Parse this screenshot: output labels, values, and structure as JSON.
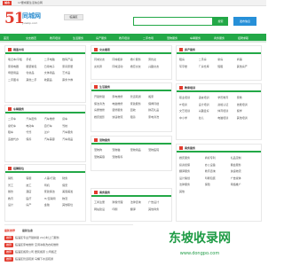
{
  "topbar": {
    "tag": "城市",
    "notice": "17要成都生活信息网"
  },
  "header": {
    "logo_num": "51",
    "brand": "同城网",
    "domain": "yuwbp.com",
    "city": "临淄区",
    "search_placeholder": "",
    "search_btn": "搜索",
    "post_btn": "发布信息"
  },
  "nav": [
    "首页",
    "交友婚恋",
    "教育培训",
    "生活服务",
    "房产服务",
    "教育培训",
    "二手市场",
    "宠物服务",
    "车辆服务",
    "商务服务",
    "招聘求职"
  ],
  "panels": {
    "market": {
      "title": "跳蚤市场",
      "links": [
        "笔记本/平板",
        "手机",
        "二手电脑",
        "数码产品",
        "家用电器",
        "服装箱包",
        "日用电子",
        "家具家居",
        "母婴用品",
        "化妆品",
        "文体用品",
        "艺术品",
        "二手图书",
        "其他二手",
        "收藏品",
        "票务卡券"
      ]
    },
    "jobs_small": {
      "title": "车辆服务",
      "links": [
        "二手车",
        "汽车配件",
        "汽车维修",
        "货车",
        "摩托车",
        "电动车",
        "自行车",
        "驾校",
        "租车",
        "代驾",
        "过户",
        "汽车服务",
        "违章代办",
        "保养",
        "汽车美容",
        "汽车用品"
      ]
    },
    "jobs": {
      "title": "招聘职位",
      "links": [
        "销售",
        "客服",
        "人事/行政",
        "财务",
        "普工",
        "技工",
        "司机",
        "保安",
        "餐饮",
        "酒店",
        "家政保洁",
        "美容美发",
        "教育",
        "医疗",
        "IT/互联网",
        "物流",
        "设计",
        "房产",
        "金融",
        "其他职位"
      ]
    },
    "friends": {
      "title": "交友婚恋",
      "links": [
        "同城交友",
        "同城相亲",
        "婚介服务",
        "男找女",
        "女找男",
        "同城活动",
        "婚恋交友",
        "兴趣交友",
        "其他交友"
      ]
    },
    "life": {
      "title": "生活服务",
      "links": [
        "开锁修锁",
        "家电维修",
        "管道疏通",
        "搬家",
        "保洁清洗",
        "电脑维修",
        "家政服务",
        "保姆月嫂",
        "房屋维修",
        "装修服务",
        "回收",
        "鲜花礼品",
        "婚庆摄影",
        "快递物流",
        "租赁",
        "家电清洗",
        "打印复印",
        "其他服务"
      ]
    },
    "pets": {
      "title": "宠物服务",
      "links": [
        "宠物狗",
        "宠物猫",
        "宠物用品",
        "宠物医院",
        "宠物美容",
        "宠物寄养"
      ]
    },
    "business": {
      "title": "商务服务",
      "links": [
        "工商注册",
        "财税代理",
        "法律咨询",
        "广告设计",
        "网站建设",
        "印刷",
        "翻译",
        "其他商务"
      ]
    },
    "realty": {
      "title": "房产服务",
      "links": [
        "租房",
        "二手房",
        "新房",
        "商铺",
        "写字楼",
        "厂房仓库",
        "短租",
        "其他房产"
      ]
    },
    "edu": {
      "title": "教育培训",
      "links": [
        "职业培训",
        "语言培训",
        "学历教育",
        "家教",
        "IT培训",
        "设计培训",
        "资格认证",
        "技能培训",
        "文艺培训",
        "兴趣爱好",
        "体育培训",
        "留学",
        "中小学",
        "幼儿",
        "电脑培训",
        "其他培训"
      ]
    },
    "other": {
      "title": "商务服务",
      "links": [
        "婚庆服务",
        "商标专利",
        "礼品定制",
        "投资担保",
        "办公设备",
        "展会服务",
        "翻译服务",
        "教育咨询",
        "快递物流",
        "设计策划",
        "印刷包装",
        "广告媒体",
        "法律服务",
        "保险",
        "网络推广",
        "其他"
      ]
    }
  },
  "news": {
    "tabs": [
      "最新推荐",
      "最新信息"
    ],
    "rows": [
      {
        "badge": "推荐",
        "text": "临淄区专业开锁换锁 24小时上门服务"
      },
      {
        "badge": "推荐",
        "text": "临淄区家电维修 空调冰箱洗衣机维修"
      },
      {
        "badge": "推荐",
        "text": "临淄区搬家公司 居民搬家 公司搬迁"
      },
      {
        "badge": "推荐",
        "text": "临淄区管道疏通 马桶下水道疏通"
      }
    ]
  },
  "watermark": {
    "big": "东坡收录网",
    "small": "www.dongpo.com"
  },
  "colors": {
    "green": "#23a847",
    "blue": "#2790d8",
    "red": "#e23b2e"
  }
}
